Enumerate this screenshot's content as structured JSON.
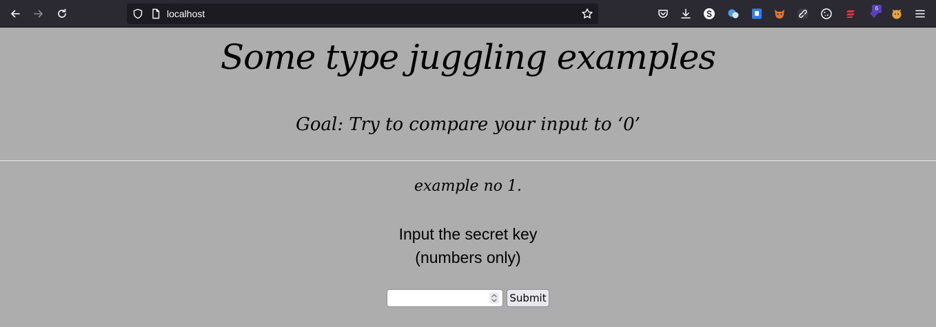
{
  "browser": {
    "url": "localhost",
    "extension_badge": "6",
    "icons": {
      "back": "arrow-left-icon",
      "forward": "arrow-right-icon",
      "reload": "reload-icon",
      "tracking_protection": "shield-icon",
      "page_info": "page-icon",
      "bookmark": "star-icon",
      "pocket": "pocket-icon",
      "downloads": "download-icon",
      "menu": "hamburger-menu-icon"
    }
  },
  "page": {
    "title": "Some type juggling examples",
    "goal": "Goal: Try to compare your input to ‘0’",
    "example_heading": "example no 1.",
    "prompt_line1": "Input the secret key",
    "prompt_line2": "(numbers only)",
    "input_value": "",
    "submit_label": "Submit"
  },
  "colors": {
    "page_background": "#adadad",
    "toolbar_background": "#2b2a33",
    "urlbar_background": "#1c1b22",
    "divider": "#eaeaea"
  }
}
